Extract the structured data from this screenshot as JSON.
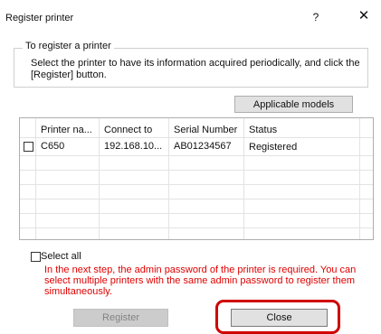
{
  "window": {
    "title": "Register printer",
    "help_label": "?",
    "close_label": "✕"
  },
  "group": {
    "legend": "To register a printer",
    "description": "Select the printer to have its information acquired periodically, and click the [Register] button."
  },
  "applicable_models_label": "Applicable models",
  "table": {
    "columns": [
      "Printer na...",
      "Connect to",
      "Serial Number",
      "Status"
    ],
    "rows": [
      {
        "checked": false,
        "printer_name": "C650",
        "connect_to": "192.168.10...",
        "serial_number": "AB01234567",
        "status": "Registered"
      }
    ]
  },
  "select_all_label": "Select all",
  "warning_text": "In the next step, the admin password of the printer is required. You can select multiple printers with the same admin password to register them simultaneously.",
  "buttons": {
    "register": "Register",
    "close": "Close"
  },
  "colors": {
    "warning": "#e00000",
    "highlight": "#d00000"
  }
}
